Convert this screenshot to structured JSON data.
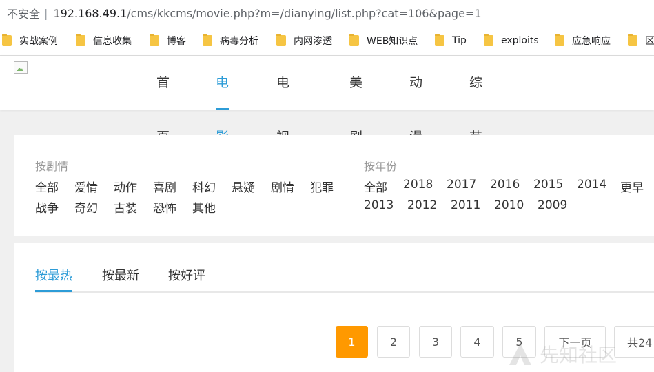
{
  "address_bar": {
    "insecure_label": "不安全",
    "separator": "|",
    "host": "192.168.49.1",
    "path": "/cms/kkcms/movie.php?m=/dianying/list.php?cat=106&page=1"
  },
  "bookmarks": [
    {
      "label": "实战案例"
    },
    {
      "label": "信息收集"
    },
    {
      "label": "博客"
    },
    {
      "label": "病毒分析"
    },
    {
      "label": "内网渗透"
    },
    {
      "label": "WEB知识点"
    },
    {
      "label": "Tip"
    },
    {
      "label": "exploits"
    },
    {
      "label": "应急响应"
    },
    {
      "label": "区"
    }
  ],
  "nav": {
    "items": [
      {
        "label": "首页",
        "active": false
      },
      {
        "label": "电影",
        "active": true
      },
      {
        "label": "电视剧",
        "active": false
      },
      {
        "label": "美剧",
        "active": false
      },
      {
        "label": "动漫",
        "active": false
      },
      {
        "label": "综艺",
        "active": false
      }
    ]
  },
  "filters": {
    "genre": {
      "title": "按剧情",
      "row1": [
        "全部",
        "爱情",
        "动作",
        "喜剧",
        "科幻",
        "悬疑",
        "剧情",
        "犯罪"
      ],
      "row2": [
        "战争",
        "奇幻",
        "古装",
        "恐怖",
        "其他"
      ]
    },
    "year": {
      "title": "按年份",
      "row1": [
        "全部",
        "2018",
        "2017",
        "2016",
        "2015",
        "2014",
        "更早"
      ],
      "row2": [
        "2013",
        "2012",
        "2011",
        "2010",
        "2009"
      ]
    }
  },
  "sort_tabs": [
    {
      "label": "按最热",
      "active": true
    },
    {
      "label": "按最新",
      "active": false
    },
    {
      "label": "按好评",
      "active": false
    }
  ],
  "pagination": {
    "pages": [
      "1",
      "2",
      "3",
      "4",
      "5"
    ],
    "current": "1",
    "next_label": "下一页",
    "total_label": "共24"
  },
  "watermark": {
    "text": "先知社区"
  },
  "colors": {
    "accent": "#2d9cd7",
    "current_page": "#ff9900",
    "folder": "#f6c543"
  }
}
